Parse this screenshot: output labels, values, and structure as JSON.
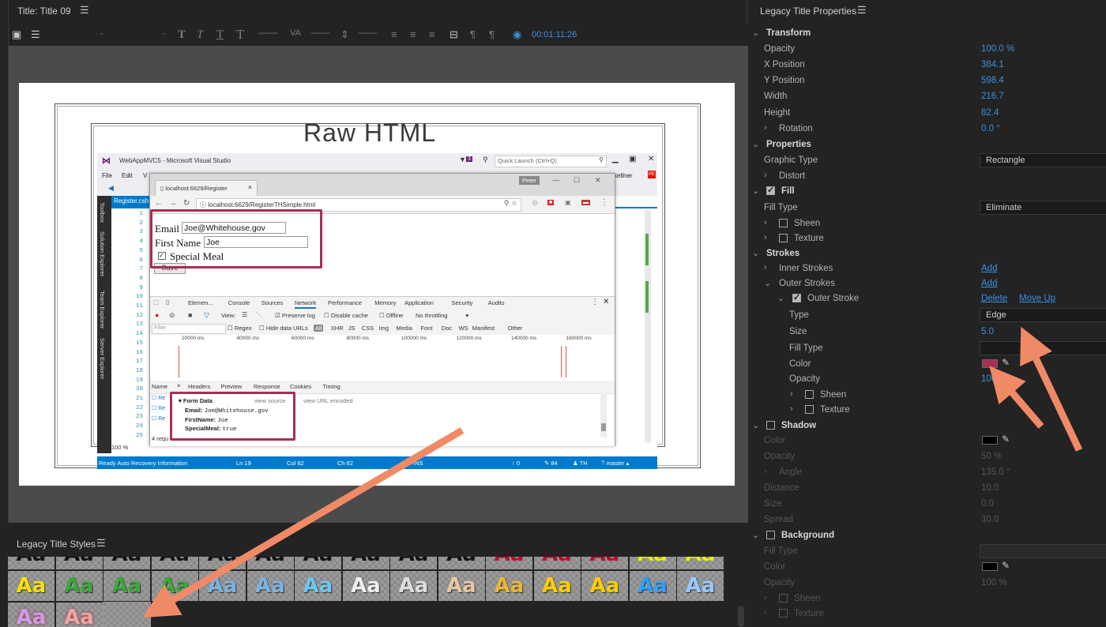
{
  "title_panel": {
    "tab_label": "Title: Title 09",
    "timecode": "00:01:11:26",
    "canvas_title": "Raw HTML"
  },
  "vs": {
    "window_title": "WebAppMVC5 - Microsoft Visual Studio",
    "notifications": "3",
    "quick_launch_placeholder": "Quick Launch (Ctrl+Q)",
    "menu": [
      "File",
      "Edit",
      "V"
    ],
    "user": "kellner",
    "user_badge": "PE",
    "file_tab": "Register.csh",
    "side_tabs": [
      "Toolbox",
      "Solution Explorer",
      "Team Explorer",
      "Server Explorer"
    ],
    "line_numbers": [
      "1",
      "2",
      "3",
      "4",
      "5",
      "6",
      "7",
      "8",
      "9",
      "10",
      "11",
      "12",
      "13",
      "14",
      "15",
      "16",
      "17",
      "18",
      "19",
      "20",
      "21",
      "22",
      "23",
      "24",
      "25"
    ],
    "zoom": "100 %",
    "status": {
      "left": "Ready   Auto Recovery Information",
      "ln": "Ln 19",
      "col": "Col 62",
      "ch": "Ch 62",
      "ins": "INS",
      "up": "0",
      "edits": "84",
      "th": "TH",
      "branch": "master"
    }
  },
  "browser": {
    "tab_label": "localhost:6629/Register",
    "profile": "Peter",
    "url": "localhost:6629/RegisterTHSimple.html",
    "form": {
      "email_label": "Email",
      "email_value": "Joe@Whitehouse.gov",
      "firstname_label": "First Name",
      "firstname_value": "Joe",
      "meal_label": "Special Meal",
      "save_label": "Save"
    },
    "devtools": {
      "tabs": [
        "Elemen...",
        "Console",
        "Sources",
        "Network",
        "Performance",
        "Memory",
        "Application",
        "Security",
        "Audits"
      ],
      "view_label": "View:",
      "preserve_log": "Preserve log",
      "disable_cache": "Disable cache",
      "offline": "Offline",
      "throttling": "No throttling",
      "filter_placeholder": "Filter",
      "regex": "Regex",
      "hide_data_urls": "Hide data URLs",
      "types": [
        "All",
        "XHR",
        "JS",
        "CSS",
        "Img",
        "Media",
        "Font",
        "Doc",
        "WS",
        "Manifest",
        "Other"
      ],
      "timeline": [
        "20000 ms",
        "40000 ms",
        "60000 ms",
        "80000 ms",
        "100000 ms",
        "120000 ms",
        "140000 ms",
        "160000 ms"
      ],
      "detail_tabs": [
        "Name",
        "Headers",
        "Preview",
        "Response",
        "Cookies",
        "Timing"
      ],
      "form_data_title": "Form Data",
      "view_source": "view source",
      "view_url_encoded": "view URL encoded",
      "fields": [
        {
          "key": "Email:",
          "value": "Joe@Whitehouse.gov"
        },
        {
          "key": "FirstName:",
          "value": "Joe"
        },
        {
          "key": "SpecialMeal:",
          "value": "true"
        }
      ],
      "requests": "4 requ",
      "row_prefix": "Re"
    }
  },
  "properties": {
    "panel_title": "Legacy Title Properties",
    "transform": {
      "section": "Transform",
      "opacity_label": "Opacity",
      "opacity": "100.0 %",
      "x_label": "X Position",
      "x": "384.1",
      "y_label": "Y Position",
      "y": "598.4",
      "width_label": "Width",
      "width": "216.7",
      "height_label": "Height",
      "height": "82.4",
      "rotation_label": "Rotation",
      "rotation": "0.0 °"
    },
    "props": {
      "section": "Properties",
      "graphic_type_label": "Graphic Type",
      "graphic_type": "Rectangle",
      "distort_label": "Distort"
    },
    "fill": {
      "section": "Fill",
      "fill_type_label": "Fill Type",
      "fill_type": "Eliminate",
      "sheen_label": "Sheen",
      "texture_label": "Texture"
    },
    "strokes": {
      "section": "Strokes",
      "inner_label": "Inner Strokes",
      "inner_add": "Add",
      "outer_label": "Outer Strokes",
      "outer_add": "Add",
      "outer_stroke_label": "Outer Stroke",
      "delete": "Delete",
      "move_up": "Move Up",
      "type_label": "Type",
      "type": "Edge",
      "size_label": "Size",
      "size": "5.0",
      "fill_type_label": "Fill Type",
      "fill_type": "",
      "color_label": "Color",
      "color": "#a72e55",
      "opacity_label": "Opacity",
      "opacity": "100",
      "sheen_label": "Sheen",
      "texture_label": "Texture"
    },
    "shadow": {
      "section": "Shadow",
      "color_label": "Color",
      "color": "#000000",
      "opacity_label": "Opacity",
      "opacity": "50 %",
      "angle_label": "Angle",
      "angle": "135.0 °",
      "distance_label": "Distance",
      "distance": "10.0",
      "size_label": "Size",
      "size": "0.0",
      "spread_label": "Spread",
      "spread": "30.0"
    },
    "background": {
      "section": "Background",
      "fill_type_label": "Fill Type",
      "color_label": "Color",
      "color": "#000000",
      "opacity_label": "Opacity",
      "opacity": "100 %",
      "sheen_label": "Sheen",
      "texture_label": "Texture"
    }
  },
  "styles_panel": {
    "title": "Legacy Title Styles",
    "swatch_text": "Aa"
  },
  "colors": {
    "accent_blue": "#3d8fe0",
    "highlight_box": "#a72e55",
    "arrow": "#f08a66"
  }
}
